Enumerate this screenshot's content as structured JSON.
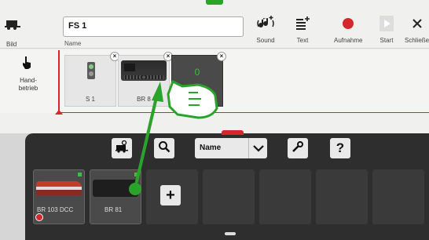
{
  "toolbar": {
    "bild_label": "Bild",
    "name_value": "FS 1",
    "name_label": "Name",
    "sound_label": "Sound",
    "text_label": "Text",
    "aufnahme_label": "Aufnahme",
    "start_label": "Start",
    "close_label": "Schließen"
  },
  "sequence": {
    "handbetrieb_label": "Hand-\nbetrieb",
    "tiles": [
      {
        "caption": "S 1"
      },
      {
        "caption": "BR 8"
      },
      {
        "caption": "",
        "value": "0"
      }
    ]
  },
  "panel": {
    "sort_value": "Name",
    "locos": [
      {
        "caption": "BR 103 DCC"
      },
      {
        "caption": "BR 81"
      }
    ]
  },
  "colors": {
    "accent_green": "#2aa32a",
    "record_red": "#d4262c",
    "panel_bg": "#2e2e2e"
  }
}
